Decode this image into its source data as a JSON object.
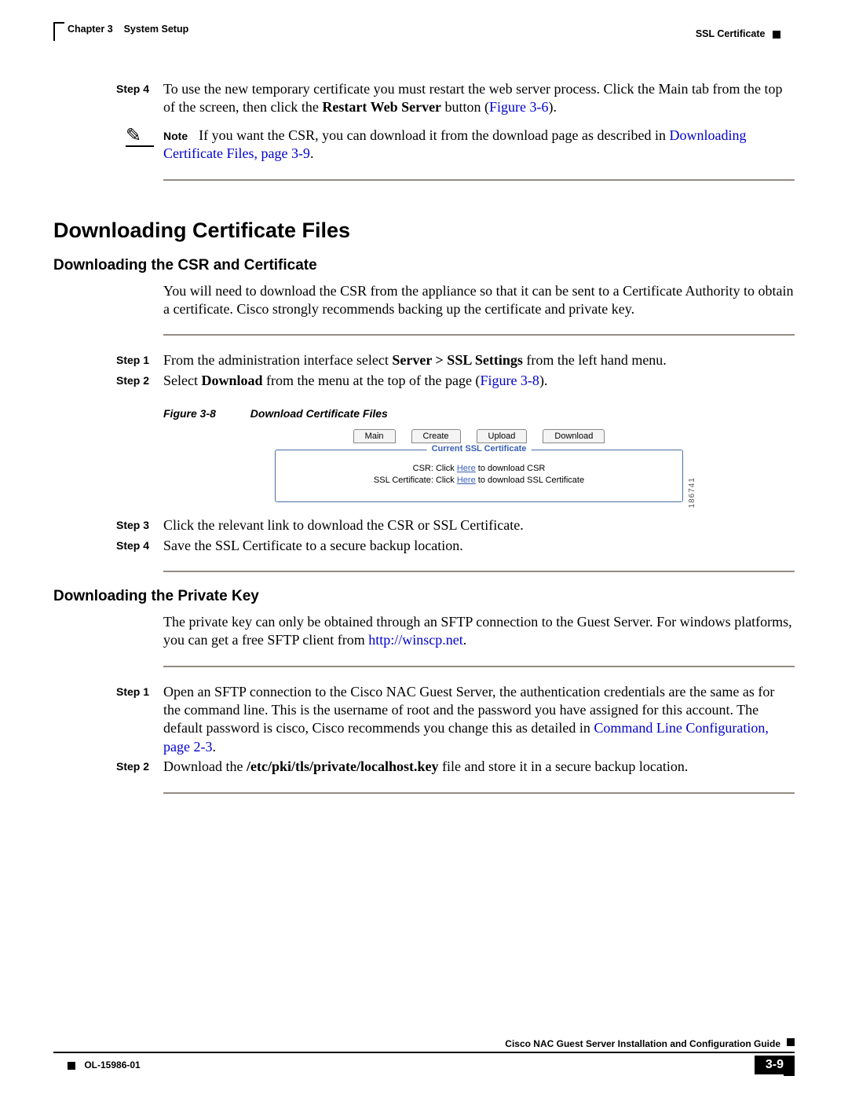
{
  "header": {
    "chapter_label": "Chapter 3",
    "chapter_title": "System Setup",
    "section_title": "SSL Certificate"
  },
  "top_step": {
    "label": "Step 4",
    "text_pre": "To use the new temporary certificate you must restart the web server process. Click the Main tab from the top of the screen, then click the ",
    "bold": "Restart Web Server",
    "text_mid": " button (",
    "figref": "Figure 3-6",
    "text_post": ")."
  },
  "note": {
    "label": "Note",
    "text_pre": "If you want the CSR, you can download it from the download page as described in ",
    "link": "Downloading Certificate Files, page 3-9",
    "text_post": "."
  },
  "h1": "Downloading Certificate Files",
  "sec1": {
    "heading": "Downloading the CSR and Certificate",
    "intro": "You will need to download the CSR from the appliance so that it can be sent to a Certificate Authority to obtain a certificate. Cisco strongly recommends backing up the certificate and private key.",
    "step1": {
      "label": "Step 1",
      "pre": "From the administration interface select ",
      "bold": "Server > SSL Settings",
      "post": " from the left hand menu."
    },
    "step2": {
      "label": "Step 2",
      "pre": "Select ",
      "bold": "Download",
      "mid": " from the menu at the top of the page (",
      "figref": "Figure 3-8",
      "post": ")."
    },
    "figure": {
      "num": "Figure 3-8",
      "title": "Download Certificate Files",
      "tabs": [
        "Main",
        "Create",
        "Upload",
        "Download"
      ],
      "legend": "Current SSL Certificate",
      "line1_pre": "CSR: Click ",
      "here1": "Here",
      "line1_post": " to download CSR",
      "line2_pre": "SSL Certificate: Click ",
      "here2": "Here",
      "line2_post": " to download SSL Certificate",
      "side_id": "186741"
    },
    "step3": {
      "label": "Step 3",
      "text": "Click the relevant link to download the CSR or SSL Certificate."
    },
    "step4": {
      "label": "Step 4",
      "text": "Save the SSL Certificate to a secure backup location."
    }
  },
  "sec2": {
    "heading": "Downloading the Private Key",
    "intro_pre": "The private key can only be obtained through an SFTP connection to the Guest Server. For windows platforms, you can get a free SFTP client from ",
    "intro_link": "http://winscp.net",
    "intro_post": ".",
    "step1": {
      "label": "Step 1",
      "pre": "Open an SFTP connection to the Cisco NAC Guest Server, the authentication credentials are the same as for the command line. This is the username of root and the password you have assigned for this account. The default password is cisco, Cisco recommends you change this as detailed in ",
      "link": "Command Line Configuration, page 2-3",
      "post": "."
    },
    "step2": {
      "label": "Step 2",
      "pre": "Download the ",
      "bold": "/etc/pki/tls/private/localhost.key",
      "post": " file and store it in a secure backup location."
    }
  },
  "footer": {
    "guide": "Cisco NAC Guest Server Installation and Configuration Guide",
    "doc_id": "OL-15986-01",
    "page": "3-9"
  }
}
